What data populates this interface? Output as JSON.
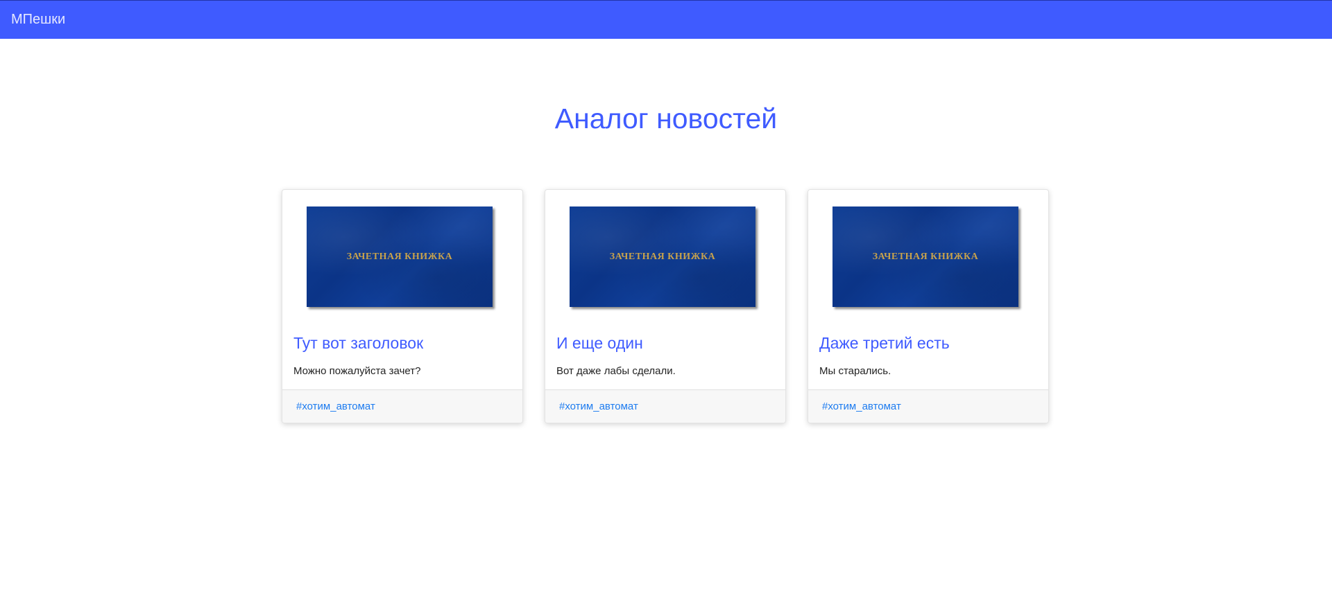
{
  "navbar": {
    "brand": "МПешки",
    "background_color": "#3f5bff"
  },
  "main": {
    "title": "Аналог новостей",
    "cards": [
      {
        "image_text": "ЗАЧЕТНАЯ КНИЖКА",
        "title": "Тут вот заголовок",
        "text": "Можно пожалуйста зачет?",
        "tag": "#хотим_автомат"
      },
      {
        "image_text": "ЗАЧЕТНАЯ КНИЖКА",
        "title": "И еще один",
        "text": "Вот даже лабы сделали.",
        "tag": "#хотим_автомат"
      },
      {
        "image_text": "ЗАЧЕТНАЯ КНИЖКА",
        "title": "Даже третий есть",
        "text": "Мы старались.",
        "tag": "#хотим_автомат"
      }
    ]
  },
  "colors": {
    "accent": "#3f5bff",
    "link": "#1e7cf0",
    "book_cover": "#0e3d95",
    "book_text": "#c7a24c"
  }
}
